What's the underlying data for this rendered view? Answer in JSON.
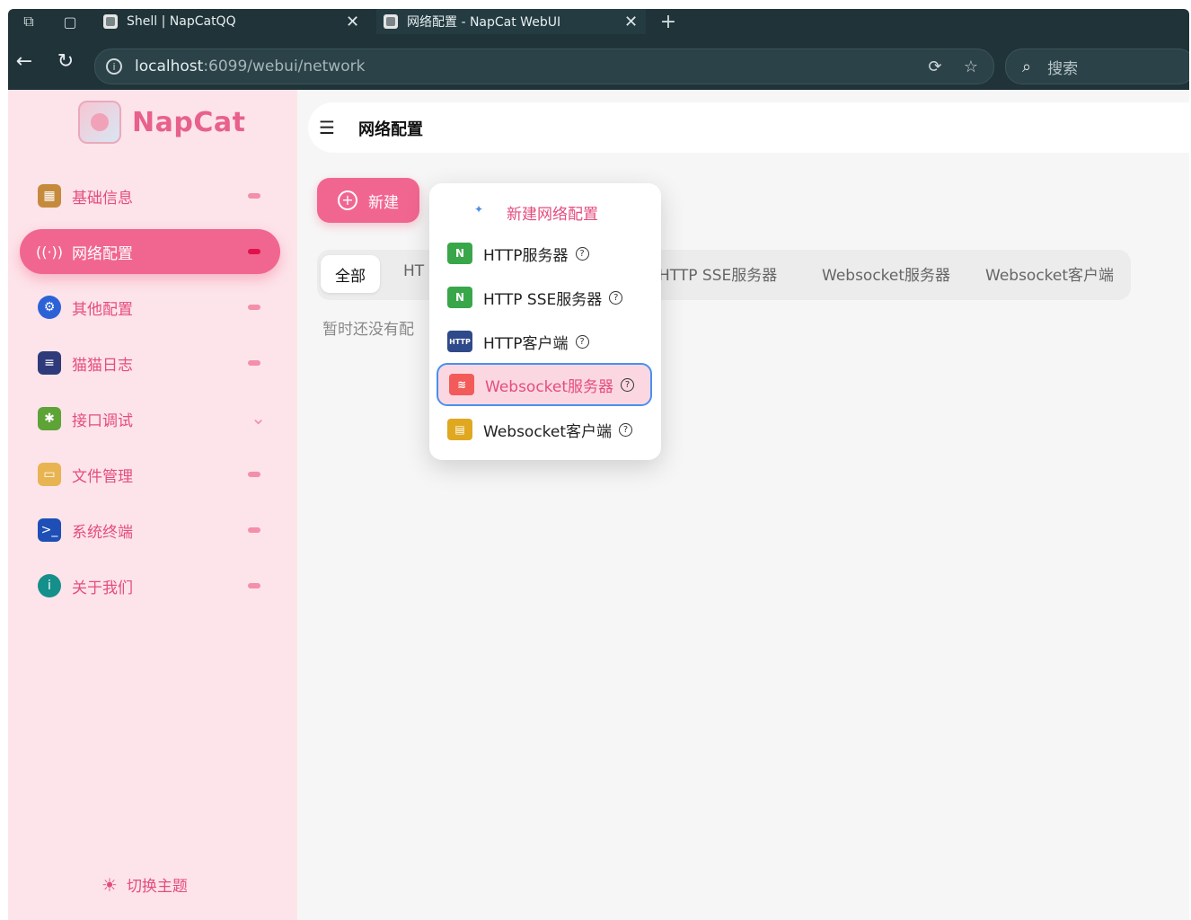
{
  "browser": {
    "tabs": [
      {
        "title": "Shell | NapCatQQ"
      },
      {
        "title": "网络配置 - NapCat WebUI"
      }
    ],
    "url_host": "localhost",
    "url_rest": ":6099/webui/network",
    "search_placeholder": "搜索"
  },
  "sidebar": {
    "logo_text": "NapCat",
    "items": [
      {
        "label": "基础信息",
        "icon": "dashboard-icon"
      },
      {
        "label": "网络配置",
        "icon": "antenna-icon"
      },
      {
        "label": "其他配置",
        "icon": "gear-icon"
      },
      {
        "label": "猫猫日志",
        "icon": "log-icon"
      },
      {
        "label": "接口调试",
        "icon": "bug-icon"
      },
      {
        "label": "文件管理",
        "icon": "folder-icon"
      },
      {
        "label": "系统终端",
        "icon": "terminal-icon"
      },
      {
        "label": "关于我们",
        "icon": "info-icon"
      }
    ],
    "theme_toggle": "切换主题"
  },
  "main": {
    "page_title": "网络配置",
    "new_button": "新建",
    "filters": [
      "全部",
      "HT",
      "HTTP SSE服务器",
      "Websocket服务器",
      "Websocket客户端"
    ],
    "empty_text": "暂时还没有配"
  },
  "dropdown": {
    "header": "新建网络配置",
    "items": [
      {
        "label": "HTTP服务器",
        "icon": "n-badge-icon"
      },
      {
        "label": "HTTP SSE服务器",
        "icon": "n-badge-icon"
      },
      {
        "label": "HTTP客户端",
        "icon": "http-monitor-icon"
      },
      {
        "label": "Websocket服务器",
        "icon": "ws-server-icon"
      },
      {
        "label": "Websocket客户端",
        "icon": "ws-client-icon"
      }
    ]
  },
  "colors": {
    "accent": "#f16690",
    "sidebar_bg": "#fde4ea",
    "chrome_bg": "#1f3338",
    "highlight_border": "#4a8ff0"
  }
}
